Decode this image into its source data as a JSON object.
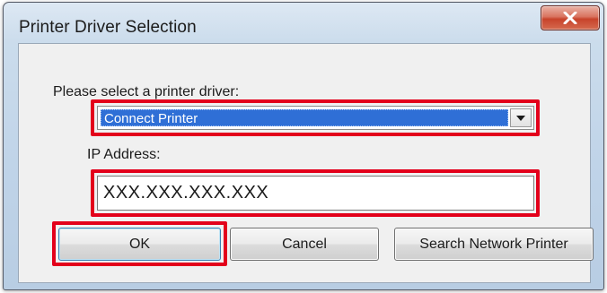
{
  "window": {
    "title": "Printer Driver Selection"
  },
  "driver": {
    "label": "Please select a printer driver:",
    "selected": "Connect Printer"
  },
  "ip": {
    "label": "IP Address:",
    "value": "XXX.XXX.XXX.XXX"
  },
  "buttons": {
    "ok": "OK",
    "cancel": "Cancel",
    "search": "Search Network Printer"
  },
  "colors": {
    "highlight": "#e3001b",
    "selection": "#2f6fd6",
    "close": "#c7432b"
  },
  "icons": {
    "close": "close-icon",
    "dropdown": "chevron-down-icon"
  }
}
